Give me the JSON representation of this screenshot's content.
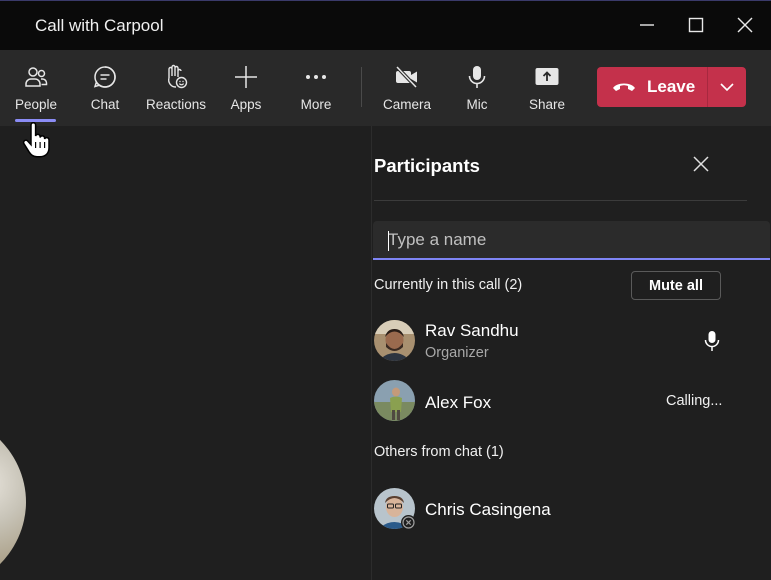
{
  "window": {
    "title": "Call with Carpool",
    "controls": [
      "minimize-icon",
      "maximize-icon",
      "close-icon"
    ]
  },
  "toolbar": {
    "items": [
      {
        "label": "People",
        "icon": "people-icon",
        "active": true
      },
      {
        "label": "Chat",
        "icon": "chat-icon"
      },
      {
        "label": "Reactions",
        "icon": "raise-hand-icon"
      },
      {
        "label": "Apps",
        "icon": "plus-icon"
      },
      {
        "label": "More",
        "icon": "more-icon"
      },
      {
        "label": "Camera",
        "icon": "camera-off-icon"
      },
      {
        "label": "Mic",
        "icon": "mic-icon"
      },
      {
        "label": "Share",
        "icon": "share-icon"
      }
    ],
    "leave_label": "Leave",
    "leave_color": "#c4314b",
    "accent_color": "#7f85f5"
  },
  "panel": {
    "title": "Participants",
    "search_placeholder": "Type a name",
    "in_call_label": "Currently in this call (2)",
    "mute_all_label": "Mute all",
    "in_call": [
      {
        "name": "Rav Sandhu",
        "role": "Organizer",
        "status": "mic-icon"
      },
      {
        "name": "Alex Fox",
        "status_text": "Calling..."
      }
    ],
    "others_label": "Others from chat (1)",
    "others": [
      {
        "name": "Chris Casingena",
        "status": "offline-icon"
      }
    ]
  }
}
